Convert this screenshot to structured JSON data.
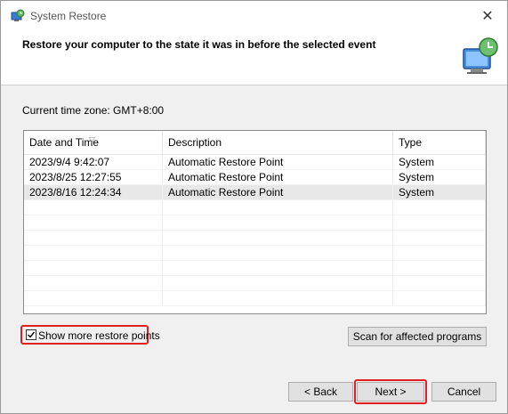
{
  "window": {
    "title": "System Restore",
    "close_glyph": "✕",
    "icons": {
      "app": "system-restore-icon",
      "header": "restore-computer-icon",
      "close": "close-icon"
    }
  },
  "header": {
    "title": "Restore your computer to the state it was in before the selected event"
  },
  "timezone": {
    "text": "Current time zone: GMT+8:00"
  },
  "table": {
    "columns": [
      "Date and Time",
      "Description",
      "Type"
    ],
    "sort_indicator": "▽",
    "rows": [
      {
        "date": "2023/9/4 9:42:07",
        "description": "Automatic Restore Point",
        "type": "System"
      },
      {
        "date": "2023/8/25 12:27:55",
        "description": "Automatic Restore Point",
        "type": "System"
      },
      {
        "date": "2023/8/16 12:24:34",
        "description": "Automatic Restore Point",
        "type": "System"
      }
    ]
  },
  "options": {
    "show_more_label": "Show more restore points",
    "show_more_checked": true
  },
  "buttons": {
    "scan": "Scan for affected programs",
    "back": "< Back",
    "next": "Next >",
    "cancel": "Cancel"
  },
  "colors": {
    "highlight": "#e02020",
    "selected_row": "#e8e8e8"
  }
}
